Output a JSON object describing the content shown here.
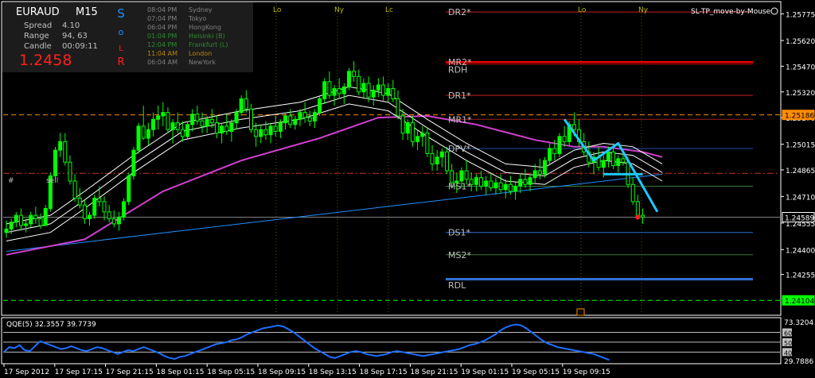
{
  "colors": {
    "background": "#000000",
    "border": "#ffffff",
    "candle": "#00ff00",
    "pivot_label": "#c0c0c0",
    "r2_line": "#ff0000",
    "r1_line": "#c02020",
    "support_line": "#3070d0",
    "ma_purple": "#d040d0",
    "envelope": "#ffffff",
    "trendline": "#1e90ff",
    "pattern": "#1ec8ff",
    "orange_dashed": "#ff8c00",
    "red_dashdot": "#c83030",
    "green_dashed": "#00ff00",
    "qqe_line": "#1e6fff"
  },
  "info_panel": {
    "symbol": "EURAUD",
    "timeframe": "M15",
    "spread_label": "Spread",
    "spread_value": "4.10",
    "range_label": "Range",
    "range_value": "94, 63",
    "candle_label": "Candle",
    "candle_value": "00:09:11",
    "price": "1.2458",
    "vertical_letters": [
      "S",
      "o",
      "L",
      "R"
    ],
    "sessions": [
      {
        "time": "08:04 PM",
        "city": "Sydney",
        "color": "#808080"
      },
      {
        "time": "07:04 PM",
        "city": "Tokyo",
        "color": "#808080"
      },
      {
        "time": "06:04 PM",
        "city": "HongKong",
        "color": "#808080"
      },
      {
        "time": "01:04 PM",
        "city": "Helsinki (B)",
        "color": "#2e8b2e"
      },
      {
        "time": "12:04 PM",
        "city": "Frankfurt (L)",
        "color": "#2e8b2e"
      },
      {
        "time": "11:04 AM",
        "city": "London",
        "color": "#b8860b"
      },
      {
        "time": "06:04 AM",
        "city": "NewYork",
        "color": "#808080"
      }
    ]
  },
  "top_markers": [
    "Lo",
    "Ny",
    "Lc",
    "Lo",
    "Ny"
  ],
  "ea_label": "SL-TP_move-by-Mouse",
  "trade_label": "#",
  "trade_label_side": "sell",
  "pivot_labels": [
    "DR2*",
    "MR2*",
    "RDH",
    "DR1*",
    "MR1*",
    "DPV*",
    "MS1*",
    "DS1*",
    "MS2*",
    "RDL"
  ],
  "price_axis": [
    "1.25775",
    "1.25620",
    "1.25470",
    "1.25320",
    "1.25170",
    "1.25015",
    "1.24865",
    "1.24710",
    "1.24555",
    "1.24400",
    "1.24255"
  ],
  "price_markers": [
    {
      "label": "1.25186",
      "bg": "#ff8c00",
      "fg": "#000000"
    },
    {
      "label": "1.24589",
      "bg": "#000000",
      "fg": "#ffffff"
    },
    {
      "label": "1.24104",
      "bg": "#00ff00",
      "fg": "#000000"
    }
  ],
  "time_axis": [
    "17 Sep 2012",
    "17 Sep 17:15",
    "17 Sep 21:15",
    "18 Sep 01:15",
    "18 Sep 05:15",
    "18 Sep 09:15",
    "18 Sep 13:15",
    "18 Sep 17:15",
    "18 Sep 21:15",
    "19 Sep 01:15",
    "19 Sep 05:15",
    "19 Sep 09:15"
  ],
  "qqe": {
    "title": "QQE(5)",
    "v1": "32.3557",
    "v2": "39.7739",
    "axis": [
      "73.3204",
      "60",
      "50",
      "40",
      "29.7886"
    ]
  },
  "chart_data": {
    "type": "candlestick",
    "price_range": [
      1.2404,
      1.2581
    ],
    "candles": [
      [
        1.245,
        1.2457,
        1.2447,
        1.2452
      ],
      [
        1.2452,
        1.2458,
        1.2449,
        1.2456
      ],
      [
        1.2456,
        1.2462,
        1.2453,
        1.246
      ],
      [
        1.246,
        1.2464,
        1.2451,
        1.2454
      ],
      [
        1.2454,
        1.2458,
        1.245,
        1.2455
      ],
      [
        1.2455,
        1.2462,
        1.2453,
        1.246
      ],
      [
        1.246,
        1.2465,
        1.2455,
        1.2458
      ],
      [
        1.2458,
        1.2461,
        1.2452,
        1.2454
      ],
      [
        1.2454,
        1.2466,
        1.2454,
        1.2464
      ],
      [
        1.2464,
        1.2485,
        1.2462,
        1.2483
      ],
      [
        1.2483,
        1.25,
        1.2481,
        1.2498
      ],
      [
        1.2498,
        1.2508,
        1.2494,
        1.2503
      ],
      [
        1.2503,
        1.2508,
        1.2489,
        1.2491
      ],
      [
        1.2491,
        1.2495,
        1.2478,
        1.248
      ],
      [
        1.248,
        1.2484,
        1.2468,
        1.247
      ],
      [
        1.247,
        1.2476,
        1.2464,
        1.2466
      ],
      [
        1.2466,
        1.2469,
        1.2455,
        1.2458
      ],
      [
        1.2458,
        1.2462,
        1.2454,
        1.246
      ],
      [
        1.246,
        1.2472,
        1.2458,
        1.247
      ],
      [
        1.247,
        1.2477,
        1.2465,
        1.2468
      ],
      [
        1.2468,
        1.2471,
        1.2457,
        1.2462
      ],
      [
        1.2462,
        1.2466,
        1.2456,
        1.2458
      ],
      [
        1.2458,
        1.2463,
        1.2453,
        1.2455
      ],
      [
        1.2455,
        1.2462,
        1.2451,
        1.2459
      ],
      [
        1.2459,
        1.247,
        1.2457,
        1.2468
      ],
      [
        1.2468,
        1.2485,
        1.2466,
        1.2483
      ],
      [
        1.2483,
        1.25,
        1.2481,
        1.2498
      ],
      [
        1.2498,
        1.2514,
        1.2496,
        1.2512
      ],
      [
        1.2512,
        1.2524,
        1.2504,
        1.2505
      ],
      [
        1.2505,
        1.2514,
        1.2501,
        1.251
      ],
      [
        1.251,
        1.252,
        1.2506,
        1.2516
      ],
      [
        1.2516,
        1.2524,
        1.251,
        1.2518
      ],
      [
        1.2518,
        1.2526,
        1.2512,
        1.252
      ],
      [
        1.252,
        1.2523,
        1.2508,
        1.251
      ],
      [
        1.251,
        1.2516,
        1.2502,
        1.2514
      ],
      [
        1.2514,
        1.252,
        1.2508,
        1.251
      ],
      [
        1.251,
        1.2515,
        1.2503,
        1.2506
      ],
      [
        1.2506,
        1.2515,
        1.2504,
        1.2513
      ],
      [
        1.2513,
        1.2522,
        1.2509,
        1.2519
      ],
      [
        1.2519,
        1.2524,
        1.2513,
        1.2515
      ],
      [
        1.2515,
        1.252,
        1.2508,
        1.2512
      ],
      [
        1.2512,
        1.2518,
        1.2508,
        1.2516
      ],
      [
        1.2516,
        1.2522,
        1.2511,
        1.2514
      ],
      [
        1.2514,
        1.2518,
        1.2505,
        1.2508
      ],
      [
        1.2508,
        1.2514,
        1.2502,
        1.2512
      ],
      [
        1.2512,
        1.2519,
        1.2507,
        1.2509
      ],
      [
        1.2509,
        1.2516,
        1.2503,
        1.2514
      ],
      [
        1.2514,
        1.2522,
        1.251,
        1.252
      ],
      [
        1.252,
        1.253,
        1.2518,
        1.2528
      ],
      [
        1.2528,
        1.2533,
        1.252,
        1.2522
      ],
      [
        1.2522,
        1.2525,
        1.2508,
        1.251
      ],
      [
        1.251,
        1.2514,
        1.25,
        1.2506
      ],
      [
        1.2506,
        1.2513,
        1.2502,
        1.251
      ],
      [
        1.251,
        1.2515,
        1.2504,
        1.2507
      ],
      [
        1.2507,
        1.2514,
        1.2502,
        1.2512
      ],
      [
        1.2512,
        1.2518,
        1.2506,
        1.2509
      ],
      [
        1.2509,
        1.2516,
        1.2505,
        1.2514
      ],
      [
        1.2514,
        1.252,
        1.251,
        1.2518
      ],
      [
        1.2518,
        1.2522,
        1.2511,
        1.2513
      ],
      [
        1.2513,
        1.2518,
        1.251,
        1.2516
      ],
      [
        1.2516,
        1.2522,
        1.2512,
        1.252
      ],
      [
        1.252,
        1.2526,
        1.2514,
        1.2517
      ],
      [
        1.2517,
        1.2521,
        1.2512,
        1.2515
      ],
      [
        1.2515,
        1.2522,
        1.2511,
        1.252
      ],
      [
        1.252,
        1.253,
        1.2518,
        1.2528
      ],
      [
        1.2528,
        1.254,
        1.2525,
        1.2538
      ],
      [
        1.2538,
        1.2544,
        1.2528,
        1.253
      ],
      [
        1.253,
        1.2536,
        1.2524,
        1.2534
      ],
      [
        1.2534,
        1.254,
        1.2528,
        1.2531
      ],
      [
        1.2531,
        1.2537,
        1.2525,
        1.2535
      ],
      [
        1.2535,
        1.2546,
        1.2533,
        1.2544
      ],
      [
        1.2544,
        1.255,
        1.2538,
        1.2541
      ],
      [
        1.2541,
        1.2545,
        1.253,
        1.2532
      ],
      [
        1.2532,
        1.254,
        1.2528,
        1.2537
      ],
      [
        1.2537,
        1.2541,
        1.2526,
        1.2529
      ],
      [
        1.2529,
        1.2536,
        1.2524,
        1.2533
      ],
      [
        1.2533,
        1.254,
        1.2529,
        1.2536
      ],
      [
        1.2536,
        1.2541,
        1.2527,
        1.253
      ],
      [
        1.253,
        1.2537,
        1.2526,
        1.2534
      ],
      [
        1.2534,
        1.2539,
        1.2526,
        1.2528
      ],
      [
        1.2528,
        1.2533,
        1.2516,
        1.2518
      ],
      [
        1.2518,
        1.2522,
        1.2504,
        1.2508
      ],
      [
        1.2508,
        1.2516,
        1.2504,
        1.2514
      ],
      [
        1.2514,
        1.2518,
        1.25,
        1.2503
      ],
      [
        1.2503,
        1.251,
        1.2498,
        1.2506
      ],
      [
        1.2506,
        1.2512,
        1.25,
        1.2508
      ],
      [
        1.2508,
        1.2511,
        1.2494,
        1.2496
      ],
      [
        1.2496,
        1.2501,
        1.2486,
        1.249
      ],
      [
        1.249,
        1.2498,
        1.2486,
        1.2494
      ],
      [
        1.2494,
        1.2499,
        1.2488,
        1.2497
      ],
      [
        1.2497,
        1.25,
        1.2484,
        1.2486
      ],
      [
        1.2486,
        1.249,
        1.2476,
        1.2479
      ],
      [
        1.2479,
        1.2485,
        1.2473,
        1.248
      ],
      [
        1.248,
        1.2488,
        1.2476,
        1.2486
      ],
      [
        1.2486,
        1.2492,
        1.2478,
        1.2481
      ],
      [
        1.2481,
        1.2485,
        1.2474,
        1.2478
      ],
      [
        1.2478,
        1.2484,
        1.2474,
        1.2482
      ],
      [
        1.2482,
        1.2486,
        1.2475,
        1.2477
      ],
      [
        1.2477,
        1.2483,
        1.2472,
        1.248
      ],
      [
        1.248,
        1.2485,
        1.2474,
        1.2476
      ],
      [
        1.2476,
        1.2482,
        1.2472,
        1.2479
      ],
      [
        1.2479,
        1.2484,
        1.2473,
        1.2475
      ],
      [
        1.2475,
        1.2481,
        1.247,
        1.2478
      ],
      [
        1.2478,
        1.2483,
        1.2472,
        1.2474
      ],
      [
        1.2474,
        1.248,
        1.2469,
        1.2477
      ],
      [
        1.2477,
        1.2484,
        1.2473,
        1.2481
      ],
      [
        1.2481,
        1.2487,
        1.2476,
        1.2478
      ],
      [
        1.2478,
        1.2484,
        1.2474,
        1.2482
      ],
      [
        1.2482,
        1.249,
        1.2479,
        1.2486
      ],
      [
        1.2486,
        1.2493,
        1.2481,
        1.2484
      ],
      [
        1.2484,
        1.2494,
        1.2482,
        1.2492
      ],
      [
        1.2492,
        1.2502,
        1.2489,
        1.2499
      ],
      [
        1.2499,
        1.2504,
        1.2492,
        1.2496
      ],
      [
        1.2496,
        1.2508,
        1.2494,
        1.2506
      ],
      [
        1.2506,
        1.2512,
        1.25,
        1.2503
      ],
      [
        1.2503,
        1.2515,
        1.2501,
        1.2513
      ],
      [
        1.2513,
        1.252,
        1.2506,
        1.251
      ],
      [
        1.251,
        1.2516,
        1.25,
        1.2503
      ],
      [
        1.2503,
        1.2508,
        1.2494,
        1.2497
      ],
      [
        1.2497,
        1.2503,
        1.2488,
        1.2491
      ],
      [
        1.2491,
        1.2497,
        1.2484,
        1.2494
      ],
      [
        1.2494,
        1.25,
        1.2486,
        1.2488
      ],
      [
        1.2488,
        1.2495,
        1.2482,
        1.2492
      ],
      [
        1.2492,
        1.25,
        1.2488,
        1.2497
      ],
      [
        1.2497,
        1.2502,
        1.2487,
        1.2489
      ],
      [
        1.2489,
        1.2495,
        1.2485,
        1.2493
      ],
      [
        1.2493,
        1.2498,
        1.2489,
        1.2491
      ],
      [
        1.2491,
        1.2494,
        1.2476,
        1.2478
      ],
      [
        1.2478,
        1.2482,
        1.2466,
        1.2468
      ],
      [
        1.2468,
        1.2472,
        1.2459,
        1.246
      ],
      [
        1.246,
        1.2464,
        1.2455,
        1.2459
      ]
    ],
    "series": [
      {
        "name": "MA",
        "points": [
          [
            0,
            1.2437
          ],
          [
            16,
            1.2446
          ],
          [
            32,
            1.2474
          ],
          [
            48,
            1.2492
          ],
          [
            64,
            1.2505
          ],
          [
            76,
            1.2517
          ],
          [
            86,
            1.2518
          ],
          [
            96,
            1.2513
          ],
          [
            108,
            1.2504
          ],
          [
            116,
            1.25
          ],
          [
            122,
            1.25
          ],
          [
            130,
            1.2497
          ],
          [
            134,
            1.2494
          ]
        ]
      },
      {
        "name": "envelope-upper",
        "points": [
          [
            0,
            1.2455
          ],
          [
            9,
            1.246
          ],
          [
            16,
            1.2474
          ],
          [
            26,
            1.2495
          ],
          [
            36,
            1.2514
          ],
          [
            48,
            1.2521
          ],
          [
            60,
            1.2526
          ],
          [
            70,
            1.2535
          ],
          [
            78,
            1.2531
          ],
          [
            86,
            1.2516
          ],
          [
            94,
            1.2502
          ],
          [
            102,
            1.249
          ],
          [
            110,
            1.2488
          ],
          [
            116,
            1.2498
          ],
          [
            122,
            1.2502
          ],
          [
            128,
            1.25
          ],
          [
            134,
            1.249
          ]
        ]
      },
      {
        "name": "envelope-mid",
        "points": [
          [
            0,
            1.245
          ],
          [
            9,
            1.2455
          ],
          [
            16,
            1.2469
          ],
          [
            26,
            1.249
          ],
          [
            36,
            1.2509
          ],
          [
            48,
            1.2516
          ],
          [
            60,
            1.2521
          ],
          [
            70,
            1.253
          ],
          [
            78,
            1.2526
          ],
          [
            86,
            1.2511
          ],
          [
            94,
            1.2497
          ],
          [
            102,
            1.2485
          ],
          [
            110,
            1.2483
          ],
          [
            116,
            1.2493
          ],
          [
            122,
            1.2497
          ],
          [
            128,
            1.2495
          ],
          [
            134,
            1.2485
          ]
        ]
      },
      {
        "name": "envelope-lower",
        "points": [
          [
            0,
            1.2445
          ],
          [
            9,
            1.245
          ],
          [
            16,
            1.2464
          ],
          [
            26,
            1.2485
          ],
          [
            36,
            1.2504
          ],
          [
            48,
            1.2511
          ],
          [
            60,
            1.2516
          ],
          [
            70,
            1.2525
          ],
          [
            78,
            1.2521
          ],
          [
            86,
            1.2506
          ],
          [
            94,
            1.2492
          ],
          [
            102,
            1.248
          ],
          [
            110,
            1.2478
          ],
          [
            116,
            1.2488
          ],
          [
            122,
            1.2492
          ],
          [
            128,
            1.249
          ],
          [
            134,
            1.248
          ]
        ]
      }
    ],
    "trendline": [
      [
        0,
        1.2439
      ],
      [
        134,
        1.2484
      ]
    ],
    "pattern_line": [
      [
        114,
        1.2516
      ],
      [
        120,
        1.2492
      ],
      [
        125,
        1.2502
      ],
      [
        133,
        1.2462
      ]
    ],
    "pattern_horizontal": [
      [
        122,
        1.2484
      ],
      [
        130,
        1.2484
      ]
    ],
    "pivot_levels": [
      1.25786,
      1.25495,
      1.25484,
      1.253,
      1.2516,
      1.2499,
      1.2477,
      1.245,
      1.2437,
      1.2423,
      1.24225
    ],
    "hlines": {
      "orange": 1.25186,
      "red_dashdot": 1.24845,
      "green_dashed": 1.24104,
      "plain": [
        1.24589
      ]
    },
    "qqe_values": [
      40,
      45,
      44,
      47,
      42,
      41,
      46,
      51,
      49,
      47,
      45,
      43,
      44,
      46,
      44,
      42,
      41,
      43,
      45,
      44,
      42,
      40,
      38,
      40,
      42,
      41,
      43,
      45,
      43,
      41,
      39,
      36,
      34,
      33,
      35,
      36,
      38,
      40,
      42,
      44,
      46,
      48,
      49,
      50,
      52,
      53,
      55,
      58,
      60,
      62,
      64,
      65,
      66,
      67,
      66,
      63,
      60,
      56,
      52,
      48,
      44,
      41,
      38,
      35,
      34,
      36,
      38,
      40,
      41,
      40,
      38,
      37,
      36,
      37,
      38,
      40,
      41,
      40,
      39,
      38,
      37,
      36,
      37,
      38,
      39,
      40,
      41,
      42,
      43,
      45,
      47,
      48,
      50,
      52,
      55,
      58,
      62,
      65,
      67,
      68,
      67,
      64,
      60,
      56,
      52,
      49,
      47,
      45,
      44,
      43,
      42,
      41,
      40,
      39,
      38,
      36,
      34,
      32
    ],
    "qqe_range": [
      29.7886,
      73.3204
    ],
    "qqe_levels": [
      60,
      50,
      40
    ]
  }
}
